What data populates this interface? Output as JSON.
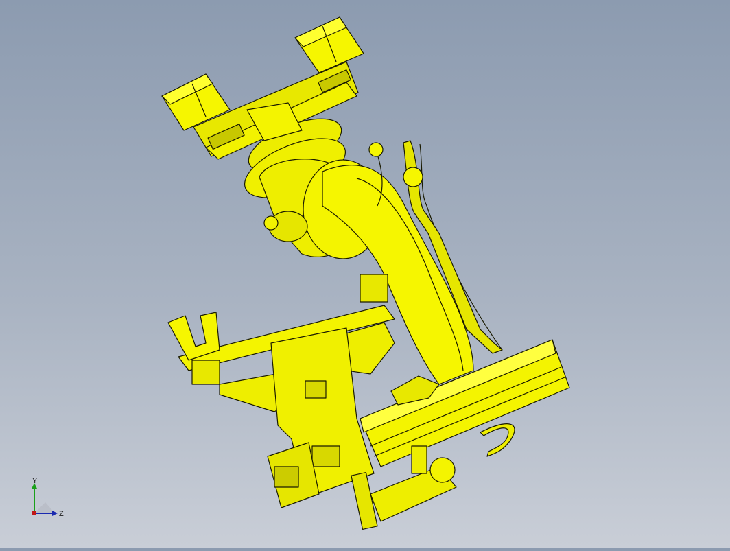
{
  "viewport": {
    "background_top": "#8c9bb0",
    "background_bottom": "#c9ced7",
    "model_color": "#f2f200",
    "edge_color": "#1a1a00"
  },
  "triad": {
    "y_label": "Y",
    "z_label": "Z",
    "y_color": "#1aa01a",
    "z_color": "#1a2ab0"
  }
}
